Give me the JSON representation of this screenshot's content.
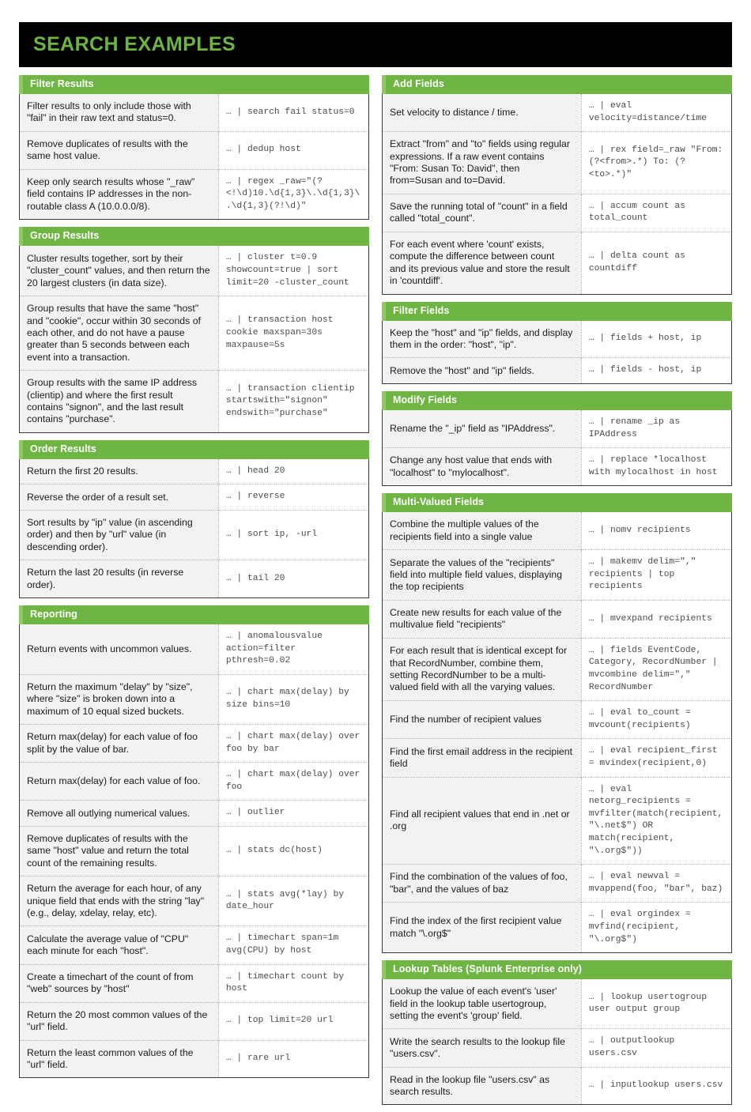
{
  "title": "SEARCH EXAMPLES",
  "theme": {
    "banner_bg": "#000000",
    "banner_text": "#6eb53f",
    "section_header_bg": "#6fb543",
    "section_header_accent": "#8cc963",
    "desc_cell_bg": "#f2f2f2",
    "cmd_cell_bg": "#ffffff",
    "border": "#3a3a3a"
  },
  "left_column": [
    {
      "heading": "Filter Results",
      "rows": [
        {
          "desc": "Filter results to only include those with \"fail\" in their raw text and status=0.",
          "cmd": "… | search fail status=0"
        },
        {
          "desc": "Remove duplicates of results with the same host value.",
          "cmd": "… | dedup host"
        },
        {
          "desc": "Keep only search results whose \"_raw\" field contains IP addresses in the non-routable class A (10.0.0.0/8).",
          "cmd": "… | regex _raw=\"(?<!\\d)10.\\d{1,3}\\.\\d{1,3}\\.\\d{1,3}(?!\\d)\""
        }
      ]
    },
    {
      "heading": "Group Results",
      "rows": [
        {
          "desc": "Cluster results together, sort by their \"cluster_count\" values, and then return the 20 largest clusters (in data size).",
          "cmd": "… | cluster t=0.9 showcount=true | sort limit=20 -cluster_count"
        },
        {
          "desc": "Group results that have the same \"host\" and \"cookie\", occur within 30 seconds of each other, and do not have a pause greater than 5 seconds between each event into a transaction.",
          "cmd": "… | transaction host cookie maxspan=30s maxpause=5s"
        },
        {
          "desc": "Group results with the same IP address (clientip) and where the first result contains \"signon\", and the last result contains \"purchase\".",
          "cmd": "… | transaction clientip startswith=\"signon\" endswith=\"purchase\""
        }
      ]
    },
    {
      "heading": "Order Results",
      "rows": [
        {
          "desc": "Return the first 20 results.",
          "cmd": "… | head 20"
        },
        {
          "desc": "Reverse the order of a result set.",
          "cmd": "… | reverse"
        },
        {
          "desc": "Sort results by \"ip\" value (in ascending order) and then by \"url\" value (in descending order).",
          "cmd": "… | sort ip, -url"
        },
        {
          "desc": "Return the last 20 results (in reverse order).",
          "cmd": "… | tail 20"
        }
      ]
    },
    {
      "heading": "Reporting",
      "rows": [
        {
          "desc": "Return events with uncommon values.",
          "cmd": "… | anomalousvalue action=filter pthresh=0.02"
        },
        {
          "desc": "Return the maximum \"delay\" by \"size\", where \"size\" is broken down into a maximum of 10 equal sized buckets.",
          "cmd": "… | chart max(delay) by size bins=10"
        },
        {
          "desc": "Return max(delay) for each value of foo split by the value of bar.",
          "cmd": "… | chart max(delay) over foo by bar"
        },
        {
          "desc": "Return max(delay) for each value of foo.",
          "cmd": "… | chart max(delay) over foo"
        },
        {
          "desc": "Remove all outlying numerical values.",
          "cmd": "… | outlier"
        },
        {
          "desc": "Remove duplicates of results with the same \"host\" value and return the total count of the remaining results.",
          "cmd": "… | stats dc(host)"
        },
        {
          "desc": "Return the average for each hour, of any unique field that ends with the string \"lay\" (e.g., delay, xdelay, relay, etc).",
          "cmd": "… | stats avg(*lay) by date_hour"
        },
        {
          "desc": "Calculate the average value of \"CPU\" each minute for each \"host\".",
          "cmd": "… | timechart span=1m avg(CPU) by host"
        },
        {
          "desc": "Create a timechart of the count of from \"web\" sources by \"host\"",
          "cmd": "… | timechart count by host"
        },
        {
          "desc": "Return the 20 most common values of the \"url\" field.",
          "cmd": "… | top limit=20 url"
        },
        {
          "desc": "Return the least common values of the \"url\" field.",
          "cmd": "… | rare url"
        }
      ]
    }
  ],
  "right_column": [
    {
      "heading": "Add Fields",
      "rows": [
        {
          "desc": "Set velocity to distance / time.",
          "cmd": "… | eval velocity=distance/time"
        },
        {
          "desc": "Extract \"from\" and \"to\" fields using regular expressions. If a raw event contains \"From: Susan To: David\", then from=Susan and to=David.",
          "cmd": "… | rex field=_raw \"From: (?<from>.*) To: (?<to>.*)\""
        },
        {
          "desc": "Save the running total of \"count\" in a field called \"total_count\".",
          "cmd": "… | accum count as total_count"
        },
        {
          "desc": "For each event where 'count' exists, compute the difference between count and its previous value and store the result in 'countdiff'.",
          "cmd": "… | delta count as countdiff"
        }
      ]
    },
    {
      "heading": "Filter Fields",
      "rows": [
        {
          "desc": "Keep the \"host\" and \"ip\" fields, and display them in the order: \"host\", \"ip\".",
          "cmd": "… | fields + host, ip"
        },
        {
          "desc": "Remove the \"host\" and \"ip\" fields.",
          "cmd": "… | fields - host, ip"
        }
      ]
    },
    {
      "heading": "Modify Fields",
      "rows": [
        {
          "desc": "Rename the \"_ip\" field as \"IPAddress\".",
          "cmd": "… | rename _ip as IPAddress"
        },
        {
          "desc": "Change any host value that ends with \"localhost\" to \"mylocalhost\".",
          "cmd": "… | replace *localhost with mylocalhost in host"
        }
      ]
    },
    {
      "heading": "Multi-Valued Fields",
      "rows": [
        {
          "desc": "Combine the multiple values of the recipients field into a single value",
          "cmd": "… | nomv recipients"
        },
        {
          "desc": "Separate the values of the \"recipients\" field into multiple field values, displaying the top recipients",
          "cmd": "… | makemv delim=\",\" recipients | top recipients"
        },
        {
          "desc": "Create new results for each value of the multivalue field \"recipients\"",
          "cmd": "… | mvexpand recipients"
        },
        {
          "desc": "For each result that is identical except for that RecordNumber, combine them, setting RecordNumber to be a multi-valued field with all the varying values.",
          "cmd": "… | fields EventCode, Category, RecordNumber | mvcombine delim=\",\" RecordNumber"
        },
        {
          "desc": "Find the number of recipient values",
          "cmd": "… | eval to_count = mvcount(recipients)"
        },
        {
          "desc": "Find the first email address in the recipient field",
          "cmd": "… | eval recipient_first = mvindex(recipient,0)"
        },
        {
          "desc": "Find all recipient values that end in .net or .org",
          "cmd": "… | eval netorg_recipients = mvfilter(match(recipient, \"\\.net$\") OR match(recipient, \"\\.org$\"))"
        },
        {
          "desc": "Find the combination of the values of foo, \"bar\", and the values of baz",
          "cmd": "… | eval newval = mvappend(foo, \"bar\", baz)"
        },
        {
          "desc": "Find the index of the first recipient value match \"\\.org$\"",
          "cmd": "… | eval orgindex = mvfind(recipient, \"\\.org$\")"
        }
      ]
    },
    {
      "heading": "Lookup Tables (Splunk Enterprise only)",
      "rows": [
        {
          "desc": "Lookup the value of each event's 'user' field in the lookup table usertogroup, setting the event's 'group' field.",
          "cmd": "… | lookup usertogroup user output group"
        },
        {
          "desc": "Write the search results to the lookup file \"users.csv\".",
          "cmd": "… | outputlookup users.csv"
        },
        {
          "desc": "Read in the lookup file \"users.csv\" as search results.",
          "cmd": "… | inputlookup users.csv"
        }
      ]
    }
  ]
}
